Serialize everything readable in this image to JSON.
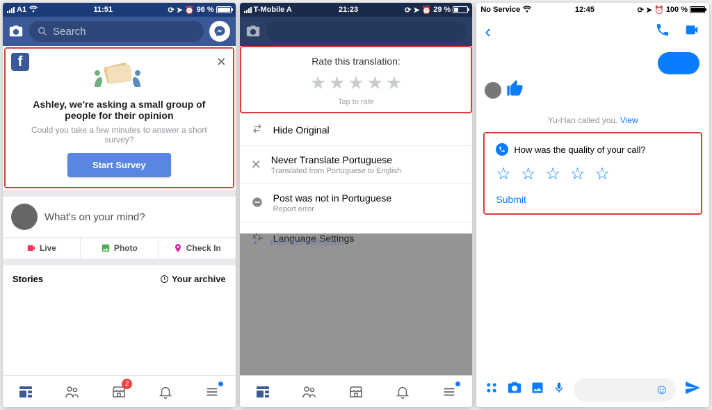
{
  "phone1": {
    "status": {
      "carrier": "A1",
      "time": "11:51",
      "battery": "96 %",
      "fill": 96
    },
    "search_placeholder": "Search",
    "survey": {
      "headline": "Ashley, we're asking a small group of people for their opinion",
      "sub": "Could you take a few minutes to answer a short survey?",
      "cta": "Start Survey"
    },
    "composer": "What's on your mind?",
    "pills": {
      "live": "Live",
      "photo": "Photo",
      "checkin": "Check In"
    },
    "stories": {
      "label": "Stories",
      "archive": "Your archive"
    },
    "badge": "2"
  },
  "phone2": {
    "status": {
      "carrier": "T-Mobile A",
      "time": "21:23",
      "battery": "29 %",
      "fill": 29
    },
    "rate": {
      "title": "Rate this translation:",
      "hint": "Tap to rate"
    },
    "rows": {
      "hide": "Hide Original",
      "never": "Never Translate Portuguese",
      "never_sub": "Translated from Portuguese to English",
      "notin": "Post was not in Portuguese",
      "notin_sub": "Report error",
      "lang": "Language Settings"
    },
    "overlay": "Rate this translation"
  },
  "phone3": {
    "status": {
      "carrier": "No Service",
      "time": "12:45",
      "battery": "100 %",
      "fill": 100
    },
    "callnote_prefix": "Yu-Han called you. ",
    "callnote_link": "View",
    "card": {
      "title": "How was the quality of your call?",
      "submit": "Submit"
    }
  }
}
